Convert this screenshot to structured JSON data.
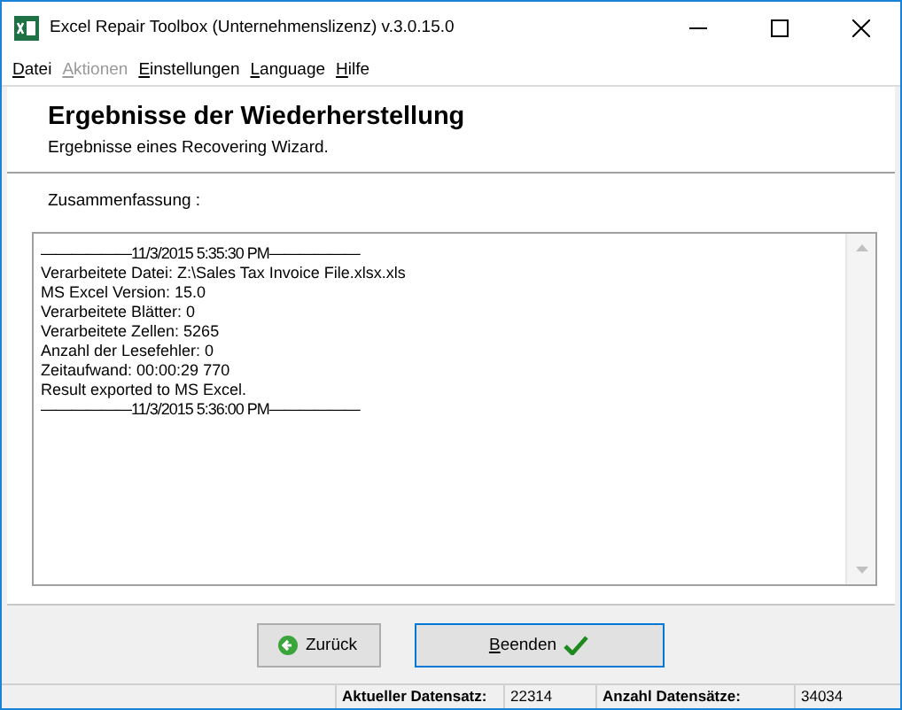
{
  "window": {
    "title": "Excel Repair Toolbox (Unternehmenslizenz) v.3.0.15.0"
  },
  "menu": [
    {
      "label": "Datei",
      "disabled": false
    },
    {
      "label": "Aktionen",
      "disabled": true
    },
    {
      "label": "Einstellungen",
      "disabled": false
    },
    {
      "label": "Language",
      "disabled": false
    },
    {
      "label": "Hilfe",
      "disabled": false
    }
  ],
  "header": {
    "title": "Ergebnisse der Wiederherstellung",
    "subtitle": "Ergebnisse eines Recovering Wizard."
  },
  "summary": {
    "label": "Zusammenfassung :",
    "lines": [
      {
        "kind": "separator",
        "text": "——————11/3/2015 5:35:30 PM——————"
      },
      {
        "kind": "text",
        "text": "Verarbeitete Datei: Z:\\Sales Tax Invoice File.xlsx.xls"
      },
      {
        "kind": "text",
        "text": "MS Excel Version: 15.0"
      },
      {
        "kind": "text",
        "text": "Verarbeitete Blätter: 0"
      },
      {
        "kind": "text",
        "text": "Verarbeitete Zellen: 5265"
      },
      {
        "kind": "text",
        "text": "Anzahl der Lesefehler: 0"
      },
      {
        "kind": "text",
        "text": "Zeitaufwand: 00:00:29 770"
      },
      {
        "kind": "text",
        "text": "Result exported to MS Excel."
      },
      {
        "kind": "separator",
        "text": "——————11/3/2015 5:36:00 PM——————"
      }
    ]
  },
  "buttons": [
    {
      "label": "Zurück",
      "kind": "back"
    },
    {
      "label": "Beenden",
      "kind": "finish"
    }
  ],
  "status_bar": {
    "current_label": "Aktueller Datensatz:",
    "current": "22314",
    "total_label": "Anzahl Datensätze:",
    "total": "34034"
  }
}
